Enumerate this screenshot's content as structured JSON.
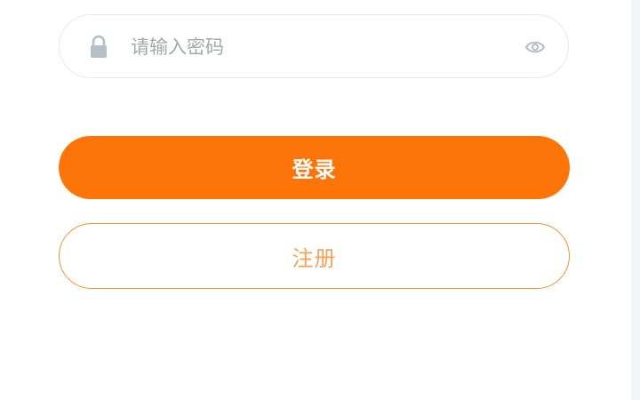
{
  "password": {
    "placeholder": "请输入密码",
    "value": "",
    "icon_left": "lock-icon",
    "icon_right": "eye-icon"
  },
  "actions": {
    "login_label": "登录",
    "register_label": "注册"
  },
  "colors": {
    "primary": "#fd7408",
    "register_border": "#f0912f",
    "register_text": "#f6a15c",
    "placeholder": "#a4a8ad",
    "icon": "#b3c0c6"
  }
}
